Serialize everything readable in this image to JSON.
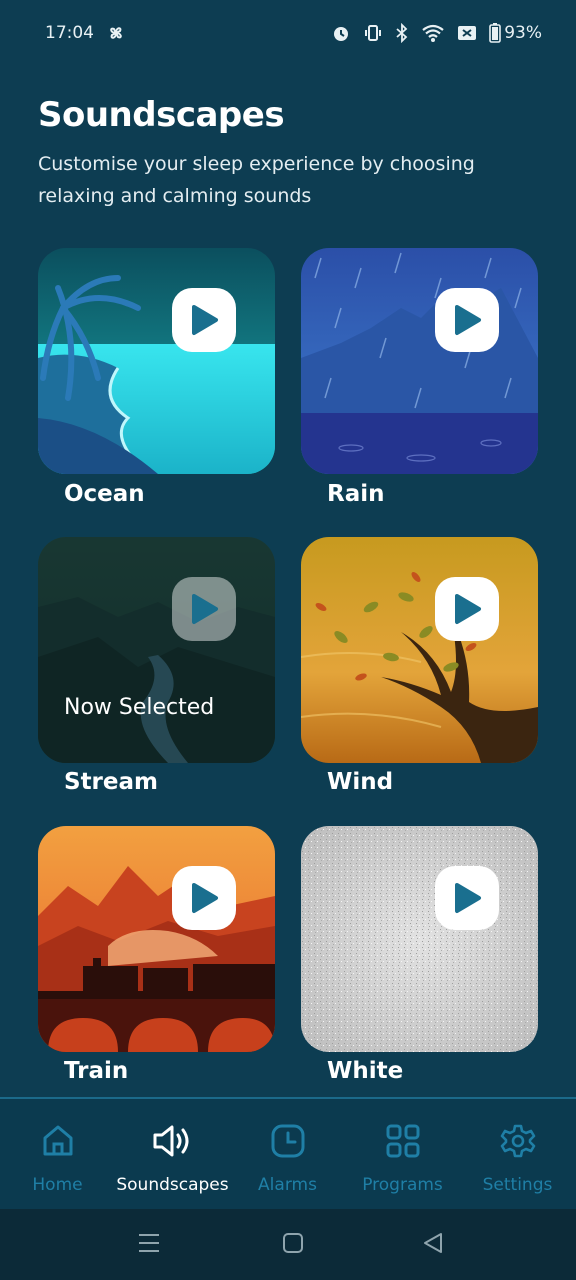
{
  "status_bar": {
    "time": "17:04",
    "battery": "93%",
    "icons": [
      "pinwheel-icon",
      "alarm-icon",
      "vibrate-icon",
      "bluetooth-icon",
      "wifi-icon",
      "data-off-icon",
      "battery-icon"
    ]
  },
  "header": {
    "title": "Soundscapes",
    "subtitle": "Customise your sleep experience by choosing relaxing and calming sounds"
  },
  "soundscapes": [
    {
      "label": "Ocean",
      "selected": false
    },
    {
      "label": "Rain",
      "selected": false
    },
    {
      "label": "Stream",
      "selected": true,
      "selected_text": "Now Selected"
    },
    {
      "label": "Wind",
      "selected": false
    },
    {
      "label": "Train",
      "selected": false
    },
    {
      "label": "White",
      "selected": false
    }
  ],
  "bottom_nav": {
    "items": [
      {
        "label": "Home",
        "icon": "home-icon",
        "active": false
      },
      {
        "label": "Soundscapes",
        "icon": "speaker-icon",
        "active": true
      },
      {
        "label": "Alarms",
        "icon": "clock-icon",
        "active": false
      },
      {
        "label": "Programs",
        "icon": "grid-icon",
        "active": false
      },
      {
        "label": "Settings",
        "icon": "gear-icon",
        "active": false
      }
    ]
  },
  "colors": {
    "background": "#0d3d52",
    "accent_inactive": "#1f7fa6",
    "play_icon": "#1a6f8f"
  }
}
